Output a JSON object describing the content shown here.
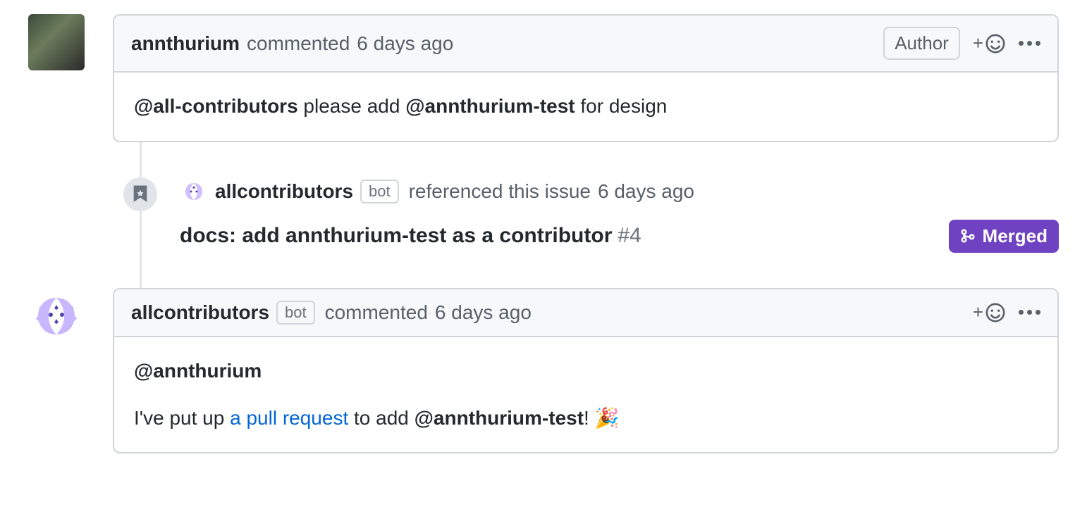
{
  "comments": [
    {
      "author": "annthurium",
      "timestamp": "6 days ago",
      "verb": "commented",
      "authorBadge": "Author",
      "body_mention1": "@all-contributors",
      "body_mid": " please add ",
      "body_mention2": "@annthurium-test",
      "body_tail": " for design"
    },
    {
      "author": "allcontributors",
      "botLabel": "bot",
      "timestamp": "6 days ago",
      "verb": "commented",
      "body_mention1": "@annthurium",
      "body_line2_pre": "I've put up ",
      "body_line2_link": "a pull request",
      "body_line2_mid": " to add ",
      "body_line2_mention": "@annthurium-test",
      "body_line2_tail": "! 🎉"
    }
  ],
  "reference": {
    "author": "allcontributors",
    "botLabel": "bot",
    "action": "referenced this issue",
    "timestamp": "6 days ago",
    "title": "docs: add annthurium-test as a contributor",
    "number": "#4",
    "status": "Merged"
  }
}
